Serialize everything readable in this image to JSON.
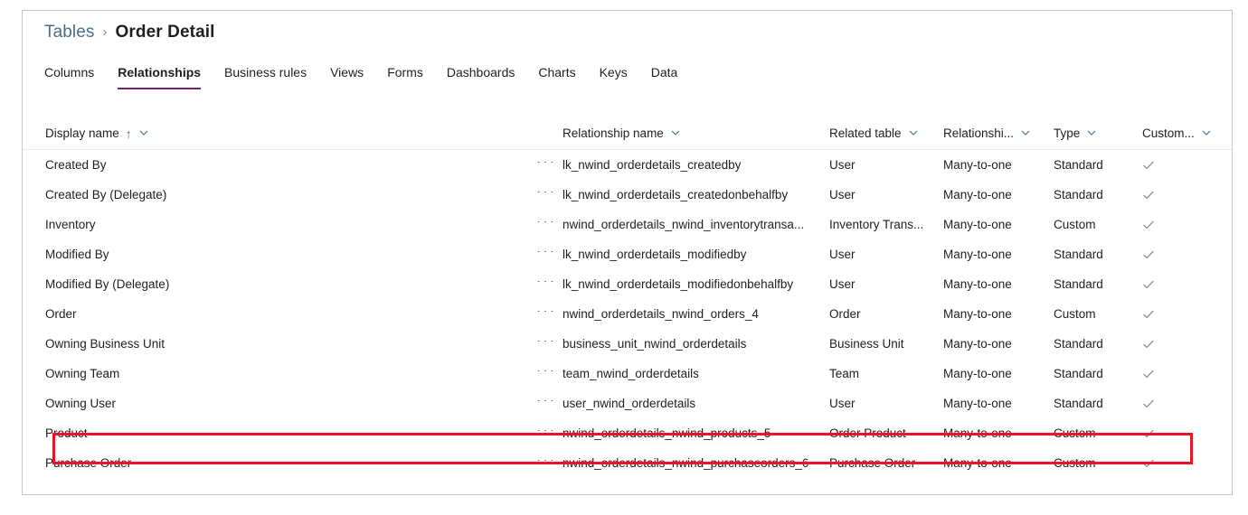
{
  "breadcrumb": {
    "parent": "Tables",
    "separator": "›",
    "current": "Order Detail"
  },
  "tabs": [
    {
      "label": "Columns",
      "active": false
    },
    {
      "label": "Relationships",
      "active": true
    },
    {
      "label": "Business rules",
      "active": false
    },
    {
      "label": "Views",
      "active": false
    },
    {
      "label": "Forms",
      "active": false
    },
    {
      "label": "Dashboards",
      "active": false
    },
    {
      "label": "Charts",
      "active": false
    },
    {
      "label": "Keys",
      "active": false
    },
    {
      "label": "Data",
      "active": false
    }
  ],
  "table": {
    "columns": [
      {
        "key": "display_name",
        "label": "Display name",
        "sorted": "ascending",
        "sort_glyph": "↑"
      },
      {
        "key": "relationship_name",
        "label": "Relationship name"
      },
      {
        "key": "related_table",
        "label": "Related table"
      },
      {
        "key": "relationship_type",
        "label": "Relationshi..."
      },
      {
        "key": "type",
        "label": "Type"
      },
      {
        "key": "customizable",
        "label": "Custom..."
      }
    ],
    "row_menu_glyph": "···",
    "rows": [
      {
        "display_name": "Created By",
        "relationship_name": "lk_nwind_orderdetails_createdby",
        "related_table": "User",
        "relationship_type": "Many-to-one",
        "type": "Standard",
        "customizable": true,
        "highlighted": false
      },
      {
        "display_name": "Created By (Delegate)",
        "relationship_name": "lk_nwind_orderdetails_createdonbehalfby",
        "related_table": "User",
        "relationship_type": "Many-to-one",
        "type": "Standard",
        "customizable": true,
        "highlighted": false
      },
      {
        "display_name": "Inventory",
        "relationship_name": "nwind_orderdetails_nwind_inventorytransa...",
        "related_table": "Inventory Trans...",
        "relationship_type": "Many-to-one",
        "type": "Custom",
        "customizable": true,
        "highlighted": false
      },
      {
        "display_name": "Modified By",
        "relationship_name": "lk_nwind_orderdetails_modifiedby",
        "related_table": "User",
        "relationship_type": "Many-to-one",
        "type": "Standard",
        "customizable": true,
        "highlighted": false
      },
      {
        "display_name": "Modified By (Delegate)",
        "relationship_name": "lk_nwind_orderdetails_modifiedonbehalfby",
        "related_table": "User",
        "relationship_type": "Many-to-one",
        "type": "Standard",
        "customizable": true,
        "highlighted": false
      },
      {
        "display_name": "Order",
        "relationship_name": "nwind_orderdetails_nwind_orders_4",
        "related_table": "Order",
        "relationship_type": "Many-to-one",
        "type": "Custom",
        "customizable": true,
        "highlighted": false
      },
      {
        "display_name": "Owning Business Unit",
        "relationship_name": "business_unit_nwind_orderdetails",
        "related_table": "Business Unit",
        "relationship_type": "Many-to-one",
        "type": "Standard",
        "customizable": true,
        "highlighted": false
      },
      {
        "display_name": "Owning Team",
        "relationship_name": "team_nwind_orderdetails",
        "related_table": "Team",
        "relationship_type": "Many-to-one",
        "type": "Standard",
        "customizable": true,
        "highlighted": false
      },
      {
        "display_name": "Owning User",
        "relationship_name": "user_nwind_orderdetails",
        "related_table": "User",
        "relationship_type": "Many-to-one",
        "type": "Standard",
        "customizable": true,
        "highlighted": false
      },
      {
        "display_name": "Product",
        "relationship_name": "nwind_orderdetails_nwind_products_5",
        "related_table": "Order Product",
        "relationship_type": "Many-to-one",
        "type": "Custom",
        "customizable": true,
        "highlighted": true
      },
      {
        "display_name": "Purchase Order",
        "relationship_name": "nwind_orderdetails_nwind_purchaseorders_6",
        "related_table": "Purchase Order",
        "relationship_type": "Many-to-one",
        "type": "Custom",
        "customizable": true,
        "highlighted": false
      }
    ]
  },
  "colors": {
    "accent_tab_underline": "#742774",
    "breadcrumb_parent": "#4a6d8c",
    "highlight_box": "#e8152a",
    "sort_arrow": "#3b6a94",
    "check": "#8a8886",
    "panel_border": "#c8c6c4"
  }
}
